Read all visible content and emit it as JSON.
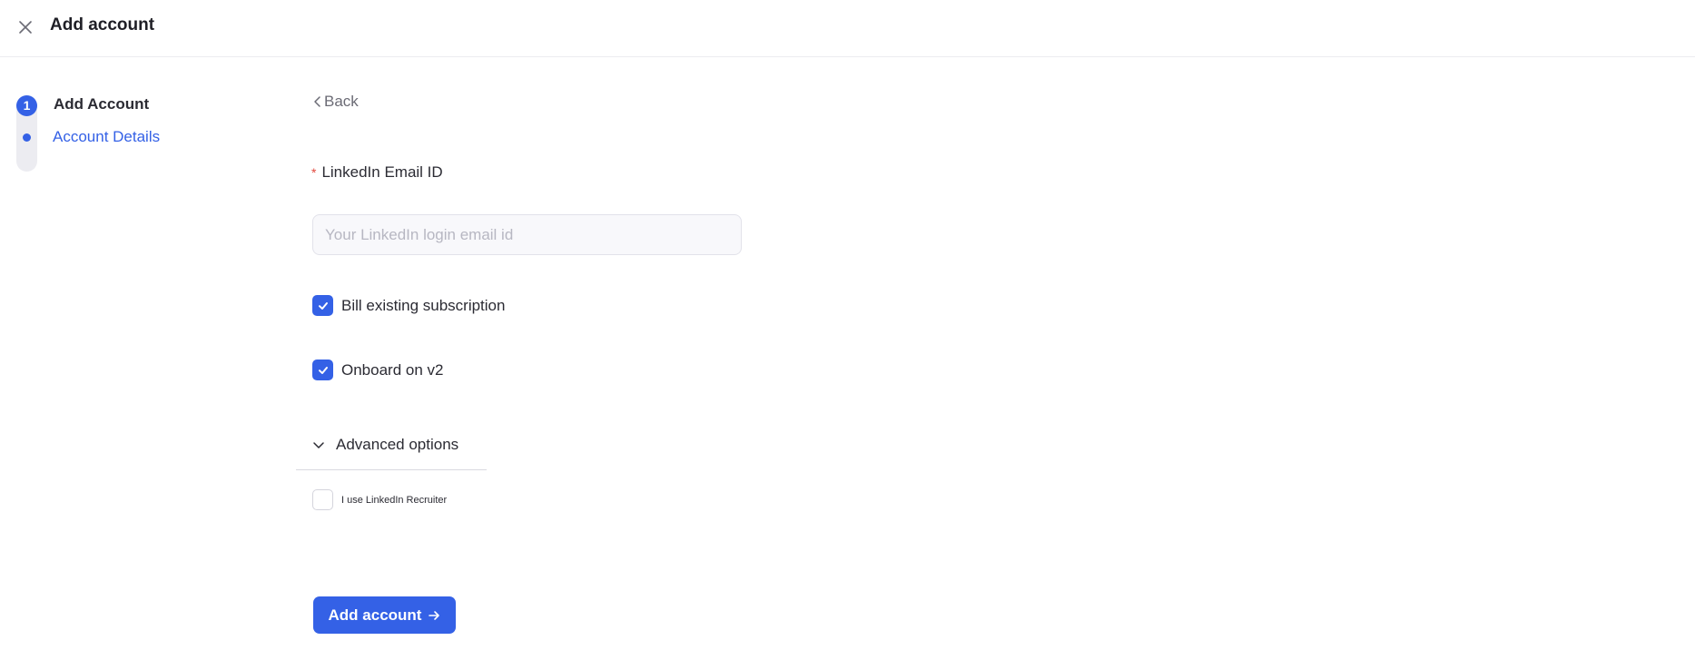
{
  "header": {
    "title": "Add account",
    "close_icon": "close-icon"
  },
  "stepper": {
    "steps": [
      {
        "number": "1",
        "label": "Add Account"
      },
      {
        "label": "Account Details"
      }
    ],
    "accent": "#3461e6"
  },
  "form": {
    "back_label": "Back",
    "email": {
      "label": "LinkedIn Email ID",
      "required_mark": "*",
      "value": "",
      "placeholder": "Your LinkedIn login email id"
    },
    "bill_existing": {
      "label": "Bill existing subscription",
      "checked": true
    },
    "onboard_v2": {
      "label": "Onboard on v2",
      "checked": true
    },
    "advanced": {
      "label": "Advanced options",
      "expanded": true
    },
    "recruiter": {
      "label": "I use LinkedIn Recruiter",
      "checked": false
    },
    "submit_label": "Add account"
  }
}
